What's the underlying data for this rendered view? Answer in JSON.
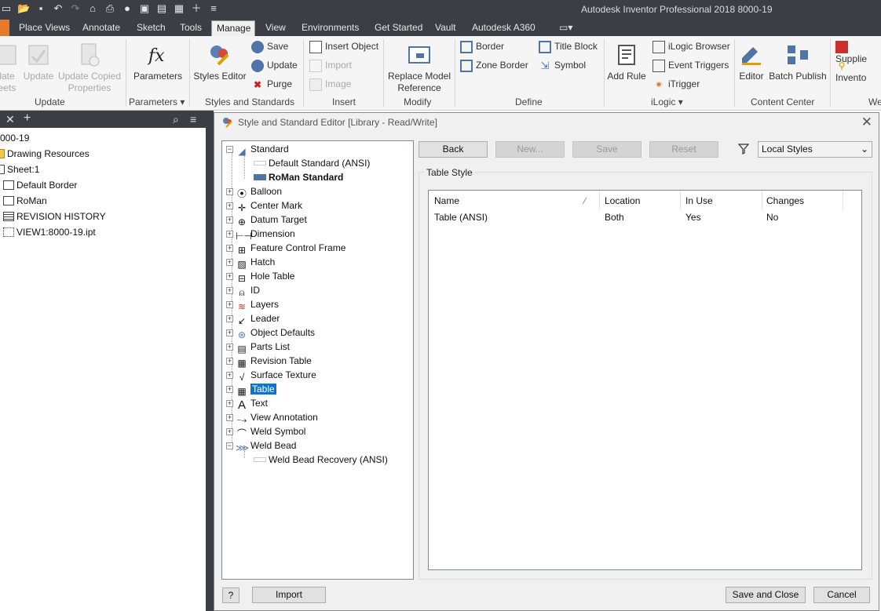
{
  "app": {
    "title": "Autodesk Inventor Professional 2018    8000-19"
  },
  "tabs": [
    "Place Views",
    "Annotate",
    "Sketch",
    "Tools",
    "Manage",
    "View",
    "Environments",
    "Get Started",
    "Vault",
    "Autodesk A360"
  ],
  "active_tab": "Manage",
  "ribbon": {
    "update_panel": {
      "label": "Update",
      "btn1": "late\neets",
      "btn2": "Update",
      "btn3a": "Update Copied",
      "btn3b": "Properties"
    },
    "parameters_panel": {
      "label": "Parameters ▾",
      "btn": "Parameters"
    },
    "styles_panel": {
      "label": "Styles and Standards",
      "editor": "Styles Editor",
      "save": "Save",
      "update": "Update",
      "purge": "Purge"
    },
    "insert_panel": {
      "label": "Insert",
      "insert_object": "Insert Object",
      "import": "Import",
      "image": "Image"
    },
    "modify_panel": {
      "label": "Modify",
      "replace1": "Replace Model",
      "replace2": "Reference"
    },
    "define_panel": {
      "label": "Define",
      "border": "Border",
      "zone_border": "Zone Border",
      "title_block": "Title Block",
      "symbol": "Symbol"
    },
    "ilogic_panel": {
      "label": "iLogic ▾",
      "add_rule": "Add Rule",
      "browser": "iLogic Browser",
      "event_triggers": "Event Triggers",
      "itrigger": "iTrigger"
    },
    "content_center": {
      "label": "Content Center",
      "editor": "Editor",
      "batch": "Batch Publish"
    },
    "extra": {
      "supplier": "Supplie",
      "inventor": "Invento",
      "we": "We"
    }
  },
  "browser": {
    "nodes": [
      "000-19",
      "Drawing Resources",
      "Sheet:1",
      "Default Border",
      "RoMan",
      "REVISION HISTORY",
      "VIEW1:8000-19.ipt"
    ]
  },
  "dialog": {
    "title": "Style and Standard Editor [Library - Read/Write]",
    "tree": {
      "standard": "Standard",
      "default_standard": "Default Standard (ANSI)",
      "roman_standard": "RoMan Standard",
      "items": [
        "Balloon",
        "Center Mark",
        "Datum Target",
        "Dimension",
        "Feature Control Frame",
        "Hatch",
        "Hole Table",
        "ID",
        "Layers",
        "Leader",
        "Object Defaults",
        "Parts List",
        "Revision Table",
        "Surface Texture",
        "Table",
        "Text",
        "View Annotation",
        "Weld Symbol",
        "Weld Bead"
      ],
      "selected": "Table",
      "weld_child": "Weld Bead Recovery (ANSI)"
    },
    "buttons": {
      "back": "Back",
      "new": "New...",
      "save": "Save",
      "reset": "Reset",
      "import": "Import",
      "save_close": "Save and Close",
      "cancel": "Cancel",
      "help": "?"
    },
    "filter_combo": "Local Styles",
    "group_label": "Table Style",
    "grid": {
      "headers": [
        "Name",
        "Location",
        "In Use",
        "Changes"
      ],
      "rows": [
        [
          "Table (ANSI)",
          "Both",
          "Yes",
          "No"
        ]
      ]
    }
  }
}
